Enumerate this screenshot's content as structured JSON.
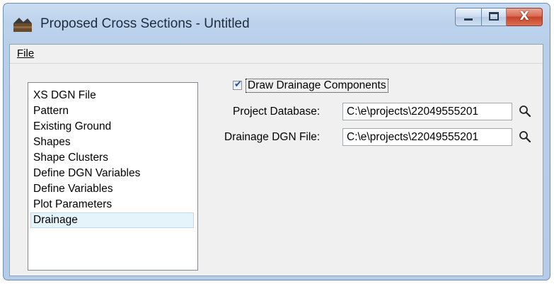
{
  "window": {
    "title": "Proposed Cross Sections - Untitled",
    "controls": {
      "minimize": "minimize",
      "maximize": "maximize",
      "close": "X"
    }
  },
  "menubar": {
    "file_label": "File"
  },
  "sidebar": {
    "items": [
      {
        "label": "XS DGN File"
      },
      {
        "label": "Pattern"
      },
      {
        "label": "Existing Ground"
      },
      {
        "label": "Shapes"
      },
      {
        "label": "Shape Clusters"
      },
      {
        "label": "Define DGN Variables"
      },
      {
        "label": "Define Variables"
      },
      {
        "label": "Plot Parameters"
      },
      {
        "label": "Drainage"
      }
    ],
    "selected": "Drainage"
  },
  "drainage": {
    "draw_components": {
      "label": "Draw Drainage Components",
      "checked": true
    },
    "project_database": {
      "label": "Project Database:",
      "value": "C:\\e\\projects\\22049555201"
    },
    "drainage_dgn_file": {
      "label": "Drainage DGN File:",
      "value": "C:\\e\\projects\\22049555201"
    }
  },
  "icons": {
    "browse": "search-icon",
    "app": "app-icon"
  },
  "colors": {
    "selection_bg": "#e5f3fb",
    "close_button": "#c7432a",
    "window_frame": "#b8cfea"
  }
}
